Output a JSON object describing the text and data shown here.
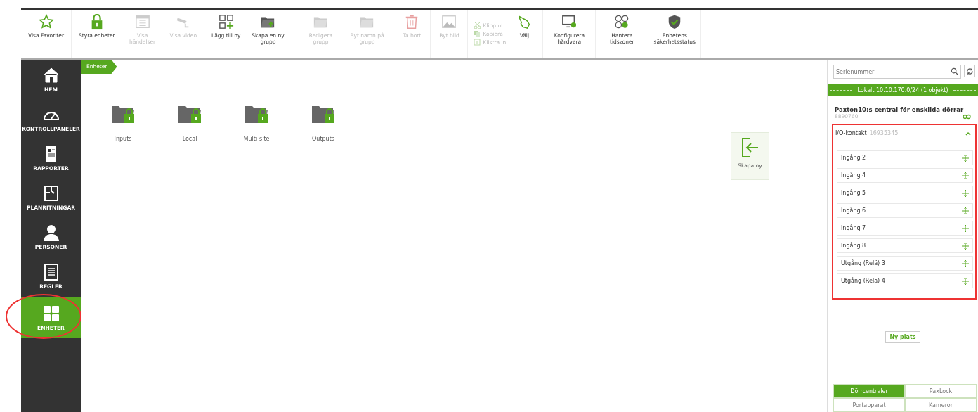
{
  "toolbar": {
    "groups": [
      {
        "items": [
          {
            "kind": "button",
            "label": "Visa Favoriter",
            "disabled": false
          }
        ]
      },
      {
        "items": [
          {
            "kind": "button",
            "label": "Styra enheter",
            "disabled": false
          },
          {
            "kind": "button",
            "label": "Visa händelser",
            "disabled": true
          },
          {
            "kind": "button",
            "label": "Visa video",
            "disabled": true
          }
        ]
      },
      {
        "items": [
          {
            "kind": "button",
            "label": "Lägg till ny",
            "disabled": false
          },
          {
            "kind": "button",
            "label": "Skapa en ny grupp",
            "disabled": false
          }
        ]
      },
      {
        "items": [
          {
            "kind": "button",
            "label": "Redigera grupp",
            "disabled": true
          },
          {
            "kind": "button",
            "label": "Byt namn på grupp",
            "disabled": true
          }
        ]
      },
      {
        "items": [
          {
            "kind": "button",
            "label": "Ta bort",
            "disabled": true
          }
        ]
      },
      {
        "items": [
          {
            "kind": "button",
            "label": "Byt bild",
            "disabled": true
          }
        ]
      },
      {
        "items": [
          {
            "kind": "stack",
            "entries": [
              {
                "label": "Klipp ut",
                "disabled": true
              },
              {
                "label": "Kopiera",
                "disabled": true
              },
              {
                "label": "Klistra in",
                "disabled": true
              }
            ]
          },
          {
            "kind": "button",
            "label": "Välj",
            "disabled": false
          }
        ]
      },
      {
        "items": [
          {
            "kind": "button",
            "label": "Konfigurera hårdvara",
            "disabled": false
          }
        ]
      },
      {
        "items": [
          {
            "kind": "button",
            "label": "Hantera tidszoner",
            "disabled": false
          }
        ]
      },
      {
        "items": [
          {
            "kind": "button",
            "label": "Enhetens säkerhetsstatus",
            "disabled": false
          }
        ]
      }
    ]
  },
  "sidebar": {
    "items": [
      {
        "label": "HEM",
        "selected": false
      },
      {
        "label": "KONTROLLPANELER",
        "selected": false
      },
      {
        "label": "RAPPORTER",
        "selected": false
      },
      {
        "label": "PLANRITNINGAR",
        "selected": false
      },
      {
        "label": "PERSONER",
        "selected": false
      },
      {
        "label": "REGLER",
        "selected": false
      },
      {
        "label": "ENHETER",
        "selected": true
      }
    ]
  },
  "breadcrumb": "Enheter",
  "folders": [
    {
      "label": "Inputs"
    },
    {
      "label": "Local"
    },
    {
      "label": "Multi-site"
    },
    {
      "label": "Outputs"
    }
  ],
  "create_button": {
    "label": "Skapa ny"
  },
  "right_panel": {
    "search": {
      "placeholder": "Serienummer"
    },
    "site_header": "Lokalt 10.10.170.0/24 (1 objekt)",
    "device": {
      "name": "Paxton10:s central för enskilda dörrar",
      "serial": "8890760"
    },
    "module": {
      "name": "I/O-kontakt",
      "serial": "16935345",
      "expanded": true,
      "items": [
        {
          "label": "Ingång 2"
        },
        {
          "label": "Ingång 4"
        },
        {
          "label": "Ingång 5"
        },
        {
          "label": "Ingång 6"
        },
        {
          "label": "Ingång 7"
        },
        {
          "label": "Ingång 8"
        },
        {
          "label": "Utgång (Relä) 3"
        },
        {
          "label": "Utgång (Relä) 4"
        }
      ]
    },
    "new_place_button": "Ny plats",
    "tabs": [
      {
        "label": "Dörrcentraler",
        "selected": true
      },
      {
        "label": "PaxLock",
        "selected": false
      },
      {
        "label": "Portapparat",
        "selected": false
      },
      {
        "label": "Kameror",
        "selected": false
      }
    ]
  }
}
